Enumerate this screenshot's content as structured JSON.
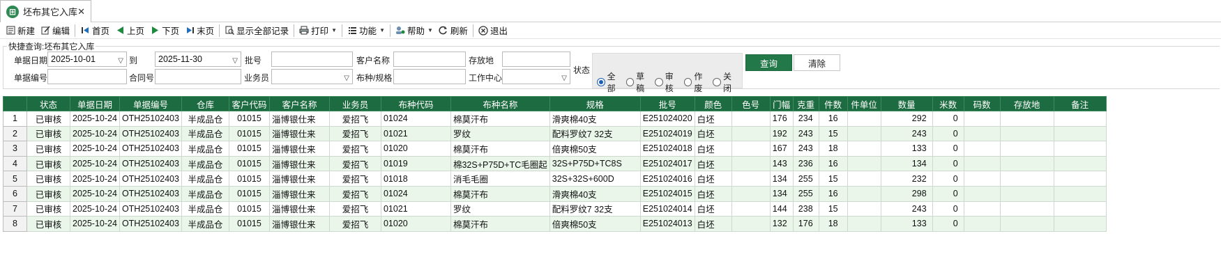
{
  "tab": {
    "title": "坯布其它入库",
    "close": "✕"
  },
  "toolbar": {
    "new": "新建",
    "edit": "编辑",
    "first": "首页",
    "prev": "上页",
    "next": "下页",
    "last": "末页",
    "show_all": "显示全部记录",
    "print": "打印",
    "function": "功能",
    "help": "帮助",
    "refresh": "刷新",
    "exit": "退出"
  },
  "query": {
    "legend": "快捷查询:坯布其它入库",
    "date_label": "单据日期",
    "date_from": "2025-10-01",
    "to_label": "到",
    "date_to": "2025-11-30",
    "batch_label": "批号",
    "batch_value": "",
    "customer_name_label": "客户名称",
    "customer_name_value": "",
    "location_label": "存放地",
    "location_value": "",
    "status_label": "状态",
    "doc_no_label": "单据编号",
    "doc_no_value": "",
    "contract_label": "合同号",
    "contract_value": "",
    "salesman_label": "业务员",
    "salesman_value": "",
    "fabric_spec_label": "布种/规格",
    "fabric_spec_value": "",
    "workcenter_label": "工作中心",
    "workcenter_value": "",
    "status_options": [
      "全部",
      "草稿",
      "审核",
      "作废",
      "关闭"
    ],
    "status_selected": "全部",
    "query_button": "查询",
    "clear_button": "清除"
  },
  "grid": {
    "columns": [
      "状态",
      "单据日期",
      "单据编号",
      "仓库",
      "客户代码",
      "客户名称",
      "业务员",
      "布种代码",
      "布种名称",
      "规格",
      "批号",
      "颜色",
      "色号",
      "门幅",
      "克重",
      "件数",
      "件单位",
      "数量",
      "米数",
      "码数",
      "存放地",
      "备注"
    ],
    "rows": [
      {
        "n": "1",
        "status": "已审核",
        "date": "2025-10-24",
        "doc": "OTH25102403",
        "wh": "半成品仓",
        "cust_code": "01015",
        "cust_name": "淄博银仕来",
        "sales": "爱招飞",
        "fab_code": "01024",
        "fab_name": "棉莫汗布",
        "spec": "滑爽棉40支",
        "batch": "E251024020",
        "color": "白坯",
        "color_no": "",
        "width": "176",
        "gsm": "234",
        "pcs": "16",
        "pcs_unit": "",
        "qty": "292",
        "meters": "0",
        "yards": "",
        "loc": "",
        "note": ""
      },
      {
        "n": "2",
        "status": "已审核",
        "date": "2025-10-24",
        "doc": "OTH25102403",
        "wh": "半成品仓",
        "cust_code": "01015",
        "cust_name": "淄博银仕来",
        "sales": "爱招飞",
        "fab_code": "01021",
        "fab_name": "罗纹",
        "spec": "配料罗纹7 32支",
        "batch": "E251024019",
        "color": "白坯",
        "color_no": "",
        "width": "192",
        "gsm": "243",
        "pcs": "15",
        "pcs_unit": "",
        "qty": "243",
        "meters": "0",
        "yards": "",
        "loc": "",
        "note": ""
      },
      {
        "n": "3",
        "status": "已审核",
        "date": "2025-10-24",
        "doc": "OTH25102403",
        "wh": "半成品仓",
        "cust_code": "01015",
        "cust_name": "淄博银仕来",
        "sales": "爱招飞",
        "fab_code": "01020",
        "fab_name": "棉莫汗布",
        "spec": "倍爽棉50支",
        "batch": "E251024018",
        "color": "白坯",
        "color_no": "",
        "width": "167",
        "gsm": "243",
        "pcs": "18",
        "pcs_unit": "",
        "qty": "133",
        "meters": "0",
        "yards": "",
        "loc": "",
        "note": ""
      },
      {
        "n": "4",
        "status": "已审核",
        "date": "2025-10-24",
        "doc": "OTH25102403",
        "wh": "半成品仓",
        "cust_code": "01015",
        "cust_name": "淄博银仕来",
        "sales": "爱招飞",
        "fab_code": "01019",
        "fab_name": "棉32S+P75D+TC毛圈起",
        "spec": "32S+P75D+TC8S",
        "batch": "E251024017",
        "color": "白坯",
        "color_no": "",
        "width": "143",
        "gsm": "236",
        "pcs": "16",
        "pcs_unit": "",
        "qty": "134",
        "meters": "0",
        "yards": "",
        "loc": "",
        "note": ""
      },
      {
        "n": "5",
        "status": "已审核",
        "date": "2025-10-24",
        "doc": "OTH25102403",
        "wh": "半成品仓",
        "cust_code": "01015",
        "cust_name": "淄博银仕来",
        "sales": "爱招飞",
        "fab_code": "01018",
        "fab_name": "消毛毛圈",
        "spec": "32S+32S+600D",
        "batch": "E251024016",
        "color": "白坯",
        "color_no": "",
        "width": "134",
        "gsm": "255",
        "pcs": "15",
        "pcs_unit": "",
        "qty": "232",
        "meters": "0",
        "yards": "",
        "loc": "",
        "note": ""
      },
      {
        "n": "6",
        "status": "已审核",
        "date": "2025-10-24",
        "doc": "OTH25102403",
        "wh": "半成品仓",
        "cust_code": "01015",
        "cust_name": "淄博银仕来",
        "sales": "爱招飞",
        "fab_code": "01024",
        "fab_name": "棉莫汗布",
        "spec": "滑爽棉40支",
        "batch": "E251024015",
        "color": "白坯",
        "color_no": "",
        "width": "134",
        "gsm": "255",
        "pcs": "16",
        "pcs_unit": "",
        "qty": "298",
        "meters": "0",
        "yards": "",
        "loc": "",
        "note": ""
      },
      {
        "n": "7",
        "status": "已审核",
        "date": "2025-10-24",
        "doc": "OTH25102403",
        "wh": "半成品仓",
        "cust_code": "01015",
        "cust_name": "淄博银仕来",
        "sales": "爱招飞",
        "fab_code": "01021",
        "fab_name": "罗纹",
        "spec": "配料罗纹7 32支",
        "batch": "E251024014",
        "color": "白坯",
        "color_no": "",
        "width": "144",
        "gsm": "238",
        "pcs": "15",
        "pcs_unit": "",
        "qty": "243",
        "meters": "0",
        "yards": "",
        "loc": "",
        "note": ""
      },
      {
        "n": "8",
        "status": "已审核",
        "date": "2025-10-24",
        "doc": "OTH25102403",
        "wh": "半成品仓",
        "cust_code": "01015",
        "cust_name": "淄博银仕来",
        "sales": "爱招飞",
        "fab_code": "01020",
        "fab_name": "棉莫汗布",
        "spec": "倍爽棉50支",
        "batch": "E251024013",
        "color": "白坯",
        "color_no": "",
        "width": "132",
        "gsm": "176",
        "pcs": "18",
        "pcs_unit": "",
        "qty": "133",
        "meters": "0",
        "yards": "",
        "loc": "",
        "note": ""
      }
    ]
  },
  "colors": {
    "header_green": "#1d6b40",
    "row_alt": "#eaf6ea",
    "accent": "#23784a"
  }
}
